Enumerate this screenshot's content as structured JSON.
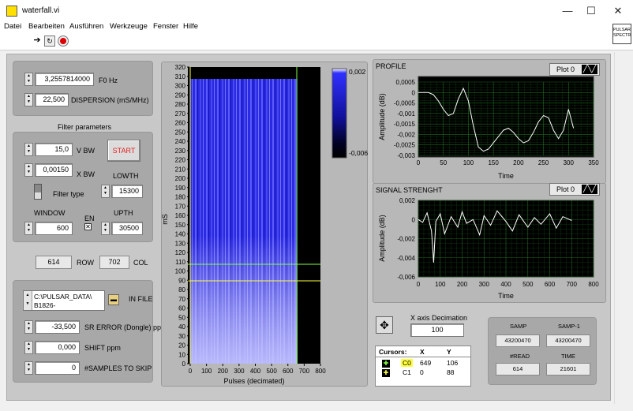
{
  "window": {
    "title": "waterfall.vi",
    "minimize": "—",
    "maximize": "☐",
    "close": "✕"
  },
  "menu": [
    "Datei",
    "Bearbeiten",
    "Ausführen",
    "Werkzeuge",
    "Fenster",
    "Hilfe"
  ],
  "toolbar": {
    "run_icon": "arrow-right-icon",
    "run_continuous_icon": "run-continuously-icon",
    "abort_icon": "abort-icon"
  },
  "vi_icon_label": "PULSAR SPECTR",
  "top_controls": {
    "f0": {
      "value": "3,2557814000",
      "label": "F0 Hz"
    },
    "dispersion": {
      "value": "22,500",
      "label": "DISPERSION (mS/MHz)"
    }
  },
  "filter": {
    "title": "Filter parameters",
    "vbw": {
      "value": "15,0",
      "label": "V BW"
    },
    "xbw": {
      "value": "0,00150",
      "label": "X BW"
    },
    "start_label": "START",
    "lowth": {
      "label": "LOWTH",
      "value": "15300"
    },
    "filter_type_label": "Filter type",
    "upth": {
      "label": "UPTH",
      "value": "30500"
    },
    "window": {
      "label": "WINDOW",
      "value": "600"
    },
    "en_label": "EN",
    "en_checked": true
  },
  "rowcol": {
    "row_value": "614",
    "row_label": "ROW",
    "col_value": "702",
    "col_label": "COL"
  },
  "file": {
    "path_line1": "C:\\PULSAR_DATA\\",
    "path_line2": "B1826-",
    "label": "IN FILE",
    "sr_error": {
      "value": "-33,500",
      "label": "SR ERROR (Dongle) ppm"
    },
    "shift": {
      "value": "0,000",
      "label": "SHIFT ppm"
    },
    "samples_skip": {
      "value": "0",
      "label": "#SAMPLES TO SKIP"
    }
  },
  "waterfall": {
    "ylabel": "mS",
    "xlabel": "Pulses (decimated)",
    "colorbar_max": "0,002",
    "colorbar_min": "-0,006",
    "y_ticks": [
      "0",
      "10",
      "20",
      "30",
      "40",
      "50",
      "60",
      "70",
      "80",
      "90",
      "100",
      "110",
      "120",
      "130",
      "140",
      "150",
      "160",
      "170",
      "180",
      "190",
      "200",
      "210",
      "220",
      "230",
      "240",
      "250",
      "260",
      "270",
      "280",
      "290",
      "300",
      "310",
      "320"
    ],
    "x_ticks": [
      "0",
      "100",
      "200",
      "300",
      "400",
      "500",
      "600",
      "700",
      "800"
    ]
  },
  "profile": {
    "title": "PROFILE",
    "plot_label": "Plot 0",
    "xlabel": "Time",
    "ylabel": "Amplitude (dB)",
    "y_ticks": [
      "0,0005",
      "0",
      "-0,0005",
      "-0,001",
      "-0,0015",
      "-0,002",
      "-0,0025",
      "-0,003"
    ],
    "x_ticks": [
      "0",
      "50",
      "100",
      "150",
      "200",
      "250",
      "300",
      "350"
    ]
  },
  "signal": {
    "title": "SIGNAL STRENGHT",
    "plot_label": "Plot 0",
    "xlabel": "Time",
    "ylabel": "Amplitude (dB)",
    "y_ticks": [
      "0,002",
      "0",
      "-0,002",
      "-0,004",
      "-0,006"
    ],
    "x_ticks": [
      "0",
      "100",
      "200",
      "300",
      "400",
      "500",
      "600",
      "700",
      "800"
    ]
  },
  "decimation": {
    "label": "X axis Decimation",
    "value": "100"
  },
  "cursors": {
    "header": [
      "Cursors:",
      "X",
      "Y"
    ],
    "rows": [
      {
        "name": "C0",
        "x": "649",
        "y": "106"
      },
      {
        "name": "C1",
        "x": "0",
        "y": "88"
      }
    ]
  },
  "status": {
    "samp_label": "SAMP",
    "samp_value": "43200470",
    "samp1_label": "SAMP-1",
    "samp1_value": "43200470",
    "read_label": "#READ",
    "read_value": "614",
    "time_label": "TIME",
    "time_value": "21601"
  },
  "chart_data": [
    {
      "type": "line",
      "title": "PROFILE",
      "xlabel": "Time",
      "ylabel": "Amplitude (dB)",
      "xlim": [
        0,
        350
      ],
      "ylim": [
        -0.003,
        0.0005
      ],
      "x": [
        0,
        10,
        20,
        30,
        40,
        50,
        60,
        70,
        80,
        90,
        100,
        110,
        120,
        130,
        140,
        150,
        160,
        170,
        180,
        190,
        200,
        210,
        220,
        230,
        240,
        250,
        260,
        270,
        280,
        290,
        300,
        310
      ],
      "series": [
        {
          "values": [
            0.0,
            0.0,
            0.0,
            -0.0001,
            -0.0004,
            -0.0008,
            -0.0011,
            -0.001,
            -0.0003,
            0.0002,
            -0.0004,
            -0.0016,
            -0.0026,
            -0.0028,
            -0.0027,
            -0.0024,
            -0.0021,
            -0.0018,
            -0.0017,
            -0.0019,
            -0.0022,
            -0.0024,
            -0.0023,
            -0.0019,
            -0.0014,
            -0.0011,
            -0.0012,
            -0.0018,
            -0.0022,
            -0.0018,
            -0.0008,
            -0.0017
          ]
        }
      ]
    },
    {
      "type": "line",
      "title": "SIGNAL STRENGHT",
      "xlabel": "Time",
      "ylabel": "Amplitude (dB)",
      "xlim": [
        0,
        800
      ],
      "ylim": [
        -0.006,
        0.002
      ],
      "x": [
        0,
        20,
        40,
        60,
        70,
        80,
        100,
        120,
        150,
        180,
        200,
        220,
        250,
        280,
        300,
        330,
        360,
        400,
        430,
        460,
        500,
        530,
        560,
        600,
        630,
        660,
        700
      ],
      "series": [
        {
          "values": [
            0.0,
            -0.0003,
            0.0007,
            -0.0012,
            -0.0045,
            -0.0002,
            0.0006,
            -0.0015,
            0.0003,
            -0.0008,
            0.0008,
            -0.0004,
            0.0,
            -0.0016,
            0.0004,
            -0.0006,
            0.0009,
            -0.0002,
            -0.0012,
            0.0005,
            -0.0008,
            0.0002,
            -0.0005,
            0.0006,
            -0.0009,
            0.0003,
            -0.0001
          ]
        }
      ]
    }
  ]
}
